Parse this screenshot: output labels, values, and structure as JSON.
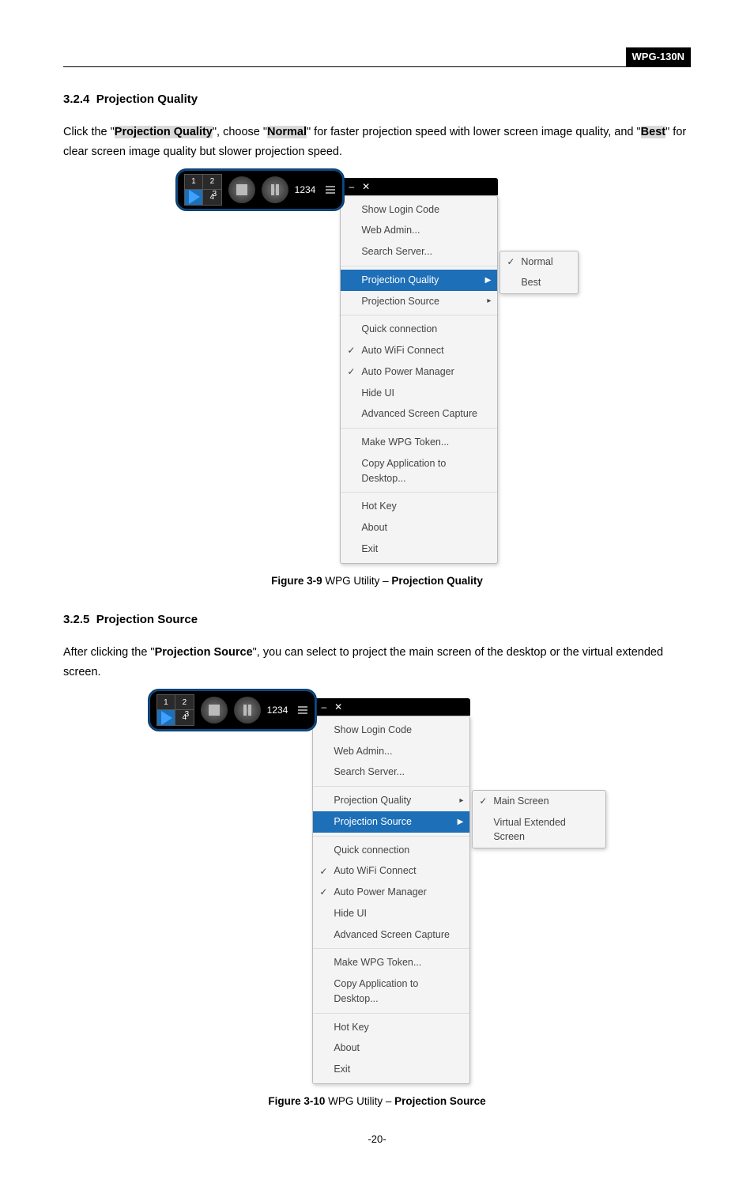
{
  "header": {
    "badge": "WPG-130N"
  },
  "section1": {
    "num": "3.2.4",
    "title": "Projection Quality",
    "text_pre": "Click the \"",
    "hl1": "Projection Quality",
    "text_mid1": "\", choose \"",
    "hl2": "Normal",
    "text_mid2": "\" for faster projection speed with lower screen image quality, and \"",
    "hl3": "Best",
    "text_post": "\" for clear screen image quality but slower projection speed."
  },
  "utility": {
    "code": "1234",
    "menu": {
      "group1": [
        "Show Login Code",
        "Web Admin...",
        "Search Server..."
      ],
      "group2": [
        {
          "label": "Projection Quality",
          "arrow": true
        },
        {
          "label": "Projection Source",
          "arrow": true
        }
      ],
      "group3": [
        {
          "label": "Quick connection"
        },
        {
          "label": "Auto WiFi Connect",
          "checked": true
        },
        {
          "label": "Auto Power Manager",
          "checked": true
        },
        {
          "label": "Hide UI"
        },
        {
          "label": "Advanced Screen Capture"
        }
      ],
      "group4": [
        "Make WPG Token...",
        "Copy Application to Desktop..."
      ],
      "group5": [
        "Hot Key",
        "About",
        "Exit"
      ]
    }
  },
  "submenu_quality": {
    "offset_rows": 0,
    "items": [
      {
        "label": "Normal",
        "checked": true
      },
      {
        "label": "Best"
      }
    ]
  },
  "caption1": {
    "fig": "Figure 3-9",
    "mid": " WPG Utility – ",
    "tail": "Projection Quality"
  },
  "section2": {
    "num": "3.2.5",
    "title": "Projection Source",
    "text_pre": "After clicking the \"",
    "hl1": "Projection Source",
    "text_post": "\", you can select to project the main screen of the desktop or the virtual extended screen."
  },
  "submenu_source": {
    "items": [
      {
        "label": "Main Screen",
        "checked": true
      },
      {
        "label": "Virtual Extended Screen"
      }
    ]
  },
  "caption2": {
    "fig": "Figure 3-10",
    "mid": " WPG Utility – ",
    "tail": "Projection Source"
  },
  "pagenum": "-20-"
}
